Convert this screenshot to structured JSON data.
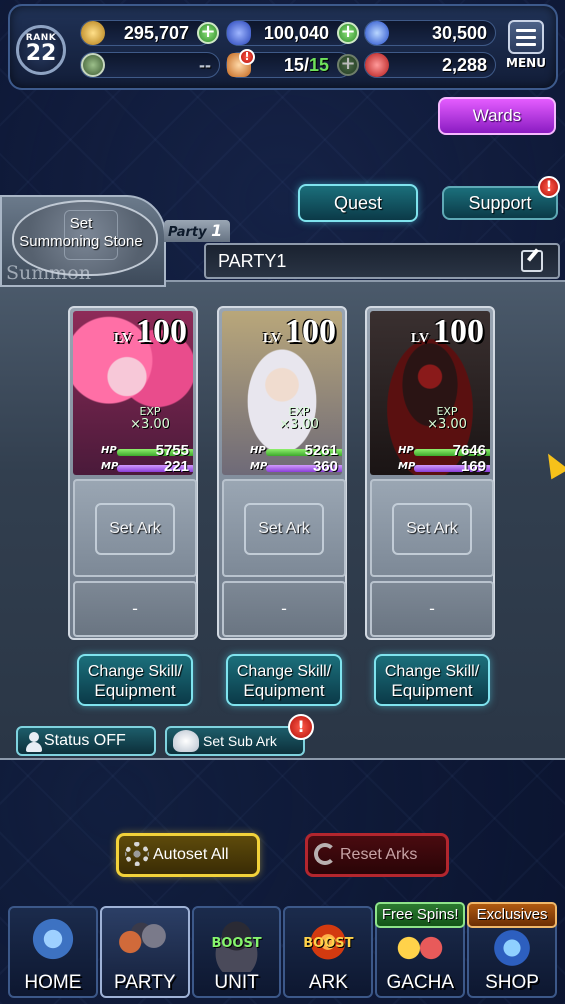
{
  "header": {
    "rank_label": "RANK",
    "rank_value": "22",
    "gold": "295,707",
    "crystals": "100,040",
    "blue_orbs": "30,500",
    "ark_stat": "--",
    "stamina_current": "15",
    "stamina_max": "15",
    "red_orbs": "2,288",
    "menu_label": "MENU",
    "alert_mark": "!"
  },
  "actions": {
    "wards": "Wards",
    "quest": "Quest",
    "support": "Support"
  },
  "summon": {
    "set_line1": "Set",
    "set_line2": "Summoning Stone",
    "label": "Summon"
  },
  "party": {
    "tag_word": "Party",
    "tag_num": "1",
    "name": "PARTY1"
  },
  "members": [
    {
      "lv_label": "LV",
      "level": "100",
      "exp_label": "EXP",
      "exp_mult": "×3.00",
      "hp_label": "HP",
      "hp": "5755",
      "mp_label": "MP",
      "mp": "221",
      "set_ark": "Set Ark",
      "sub": "-",
      "skill_line1": "Change Skill/",
      "skill_line2": "Equipment"
    },
    {
      "lv_label": "LV",
      "level": "100",
      "exp_label": "EXP",
      "exp_mult": "×3.00",
      "hp_label": "HP",
      "hp": "5261",
      "mp_label": "MP",
      "mp": "360",
      "set_ark": "Set Ark",
      "sub": "-",
      "skill_line1": "Change Skill/",
      "skill_line2": "Equipment"
    },
    {
      "lv_label": "LV",
      "level": "100",
      "exp_label": "EXP",
      "exp_mult": "×3.00",
      "hp_label": "HP",
      "hp": "7646",
      "mp_label": "MP",
      "mp": "169",
      "set_ark": "Set Ark",
      "sub": "-",
      "skill_line1": "Change Skill/",
      "skill_line2": "Equipment"
    }
  ],
  "controls": {
    "status": "Status OFF",
    "sub_ark": "Set Sub Ark",
    "autoset": "Autoset All",
    "reset": "Reset Arks"
  },
  "nav": {
    "home": "HOME",
    "party": "PARTY",
    "unit": "UNIT",
    "unit_boost": "BOOST",
    "ark": "ARK",
    "ark_boost": "BOOST",
    "gacha": "GACHA",
    "gacha_badge": "Free Spins!",
    "shop": "SHOP",
    "shop_badge": "Exclusives"
  },
  "colors": {
    "accent_teal": "#7fe3ee",
    "wards_purple": "#e45cff",
    "hp_green": "#3da82c",
    "mp_purple": "#8a3ed8",
    "alert_red": "#d0140c"
  }
}
